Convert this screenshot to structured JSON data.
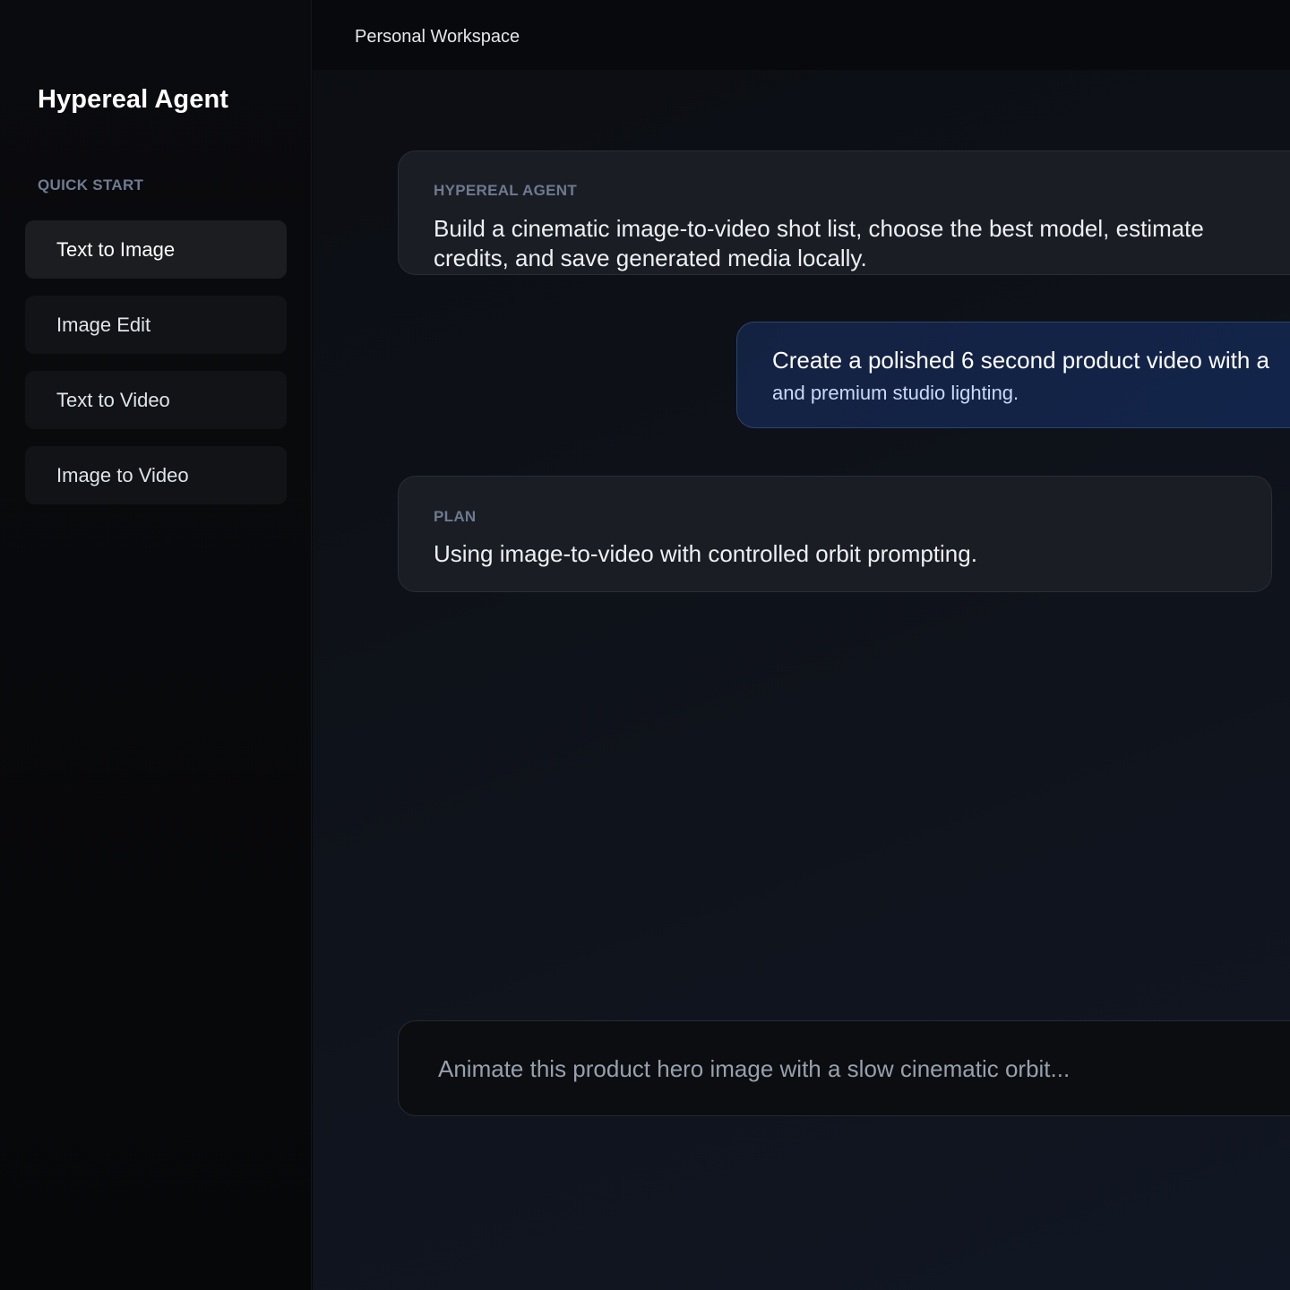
{
  "sidebar": {
    "brand": "Hypereal Agent",
    "section_label": "QUICK START",
    "items": [
      {
        "label": "Text to Image",
        "active": true
      },
      {
        "label": "Image Edit",
        "active": false
      },
      {
        "label": "Text to Video",
        "active": false
      },
      {
        "label": "Image to Video",
        "active": false
      }
    ]
  },
  "header": {
    "workspace": "Personal Workspace"
  },
  "messages": {
    "agent": {
      "label": "HYPEREAL AGENT",
      "text": "Build a cinematic image-to-video shot list, choose the best model, estimate credits, and save generated media locally."
    },
    "user": {
      "line1": "Create a polished 6 second product video with a",
      "line2": "and premium studio lighting."
    },
    "plan": {
      "label": "PLAN",
      "text": "Using image-to-video with controlled orbit prompting."
    }
  },
  "composer": {
    "placeholder": "Animate this product hero image with a slow cinematic orbit..."
  },
  "colors": {
    "sidebar_bg": "#0a0b0e",
    "main_bg": "#0f131b",
    "card_bg": "#1a1d24",
    "user_bubble_bg": "#142242",
    "label_muted": "#6e7a90"
  }
}
